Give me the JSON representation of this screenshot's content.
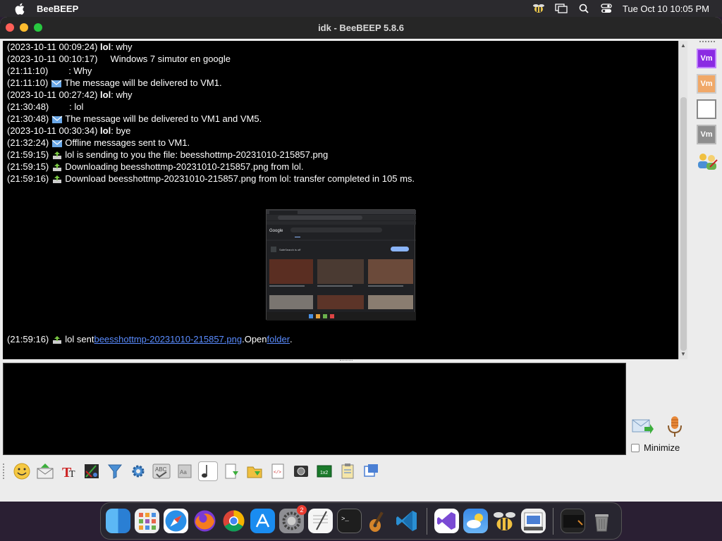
{
  "menubar": {
    "app_name": "BeeBEEP",
    "clock": "Tue Oct 10  10:05 PM"
  },
  "window": {
    "title": "idk - BeeBEEP 5.8.6"
  },
  "chat": {
    "messages": [
      {
        "ts": "(2023-10-11 00:09:24)",
        "who": "lol",
        "text": ": why"
      },
      {
        "ts": "(2023-10-11 00:10:17)",
        "who": "",
        "text": "Windows 7 simutor en google"
      },
      {
        "ts": "(21:11:10)",
        "who": "",
        "text": ": Why"
      },
      {
        "ts": "(21:11:10)",
        "who": "",
        "text": "The message will be delivered to VM1."
      },
      {
        "ts": "(2023-10-11 00:27:42)",
        "who": "lol",
        "text": ": why"
      },
      {
        "ts": "(21:30:48)",
        "who": "",
        "text": ": lol"
      },
      {
        "ts": "(21:30:48)",
        "who": "",
        "text": "The message will be delivered to VM1 and VM5."
      },
      {
        "ts": "(2023-10-11 00:30:34)",
        "who": "lol",
        "text": ": bye"
      },
      {
        "ts": "(21:32:24)",
        "who": "",
        "text": "Offline messages sent to VM1."
      },
      {
        "ts": "(21:59:15)",
        "who": "",
        "text": "lol is sending to you the file: beesshottmp-20231010-215857.png"
      },
      {
        "ts": "(21:59:15)",
        "who": "",
        "text": "Downloading beesshottmp-20231010-215857.png from lol."
      },
      {
        "ts": "(21:59:16)",
        "who": "",
        "text": "Download beesshottmp-20231010-215857.png from lol: transfer completed in 105 ms."
      }
    ],
    "final": {
      "ts": "(21:59:16)",
      "prefix": "lol sent ",
      "file_link": "beesshottmp-20231010-215857.png",
      "middle": ".Open ",
      "folder_link": "folder",
      "suffix": "."
    },
    "thumbnail": {
      "search_query": "Google",
      "safesearch": "SafeSearch is off"
    }
  },
  "compose": {
    "minimize_label": "Minimize"
  },
  "sidebar": {
    "vm_labels": [
      "Vm",
      "Vm",
      "",
      "Vm"
    ]
  },
  "dock": {
    "settings_badge": "2"
  }
}
